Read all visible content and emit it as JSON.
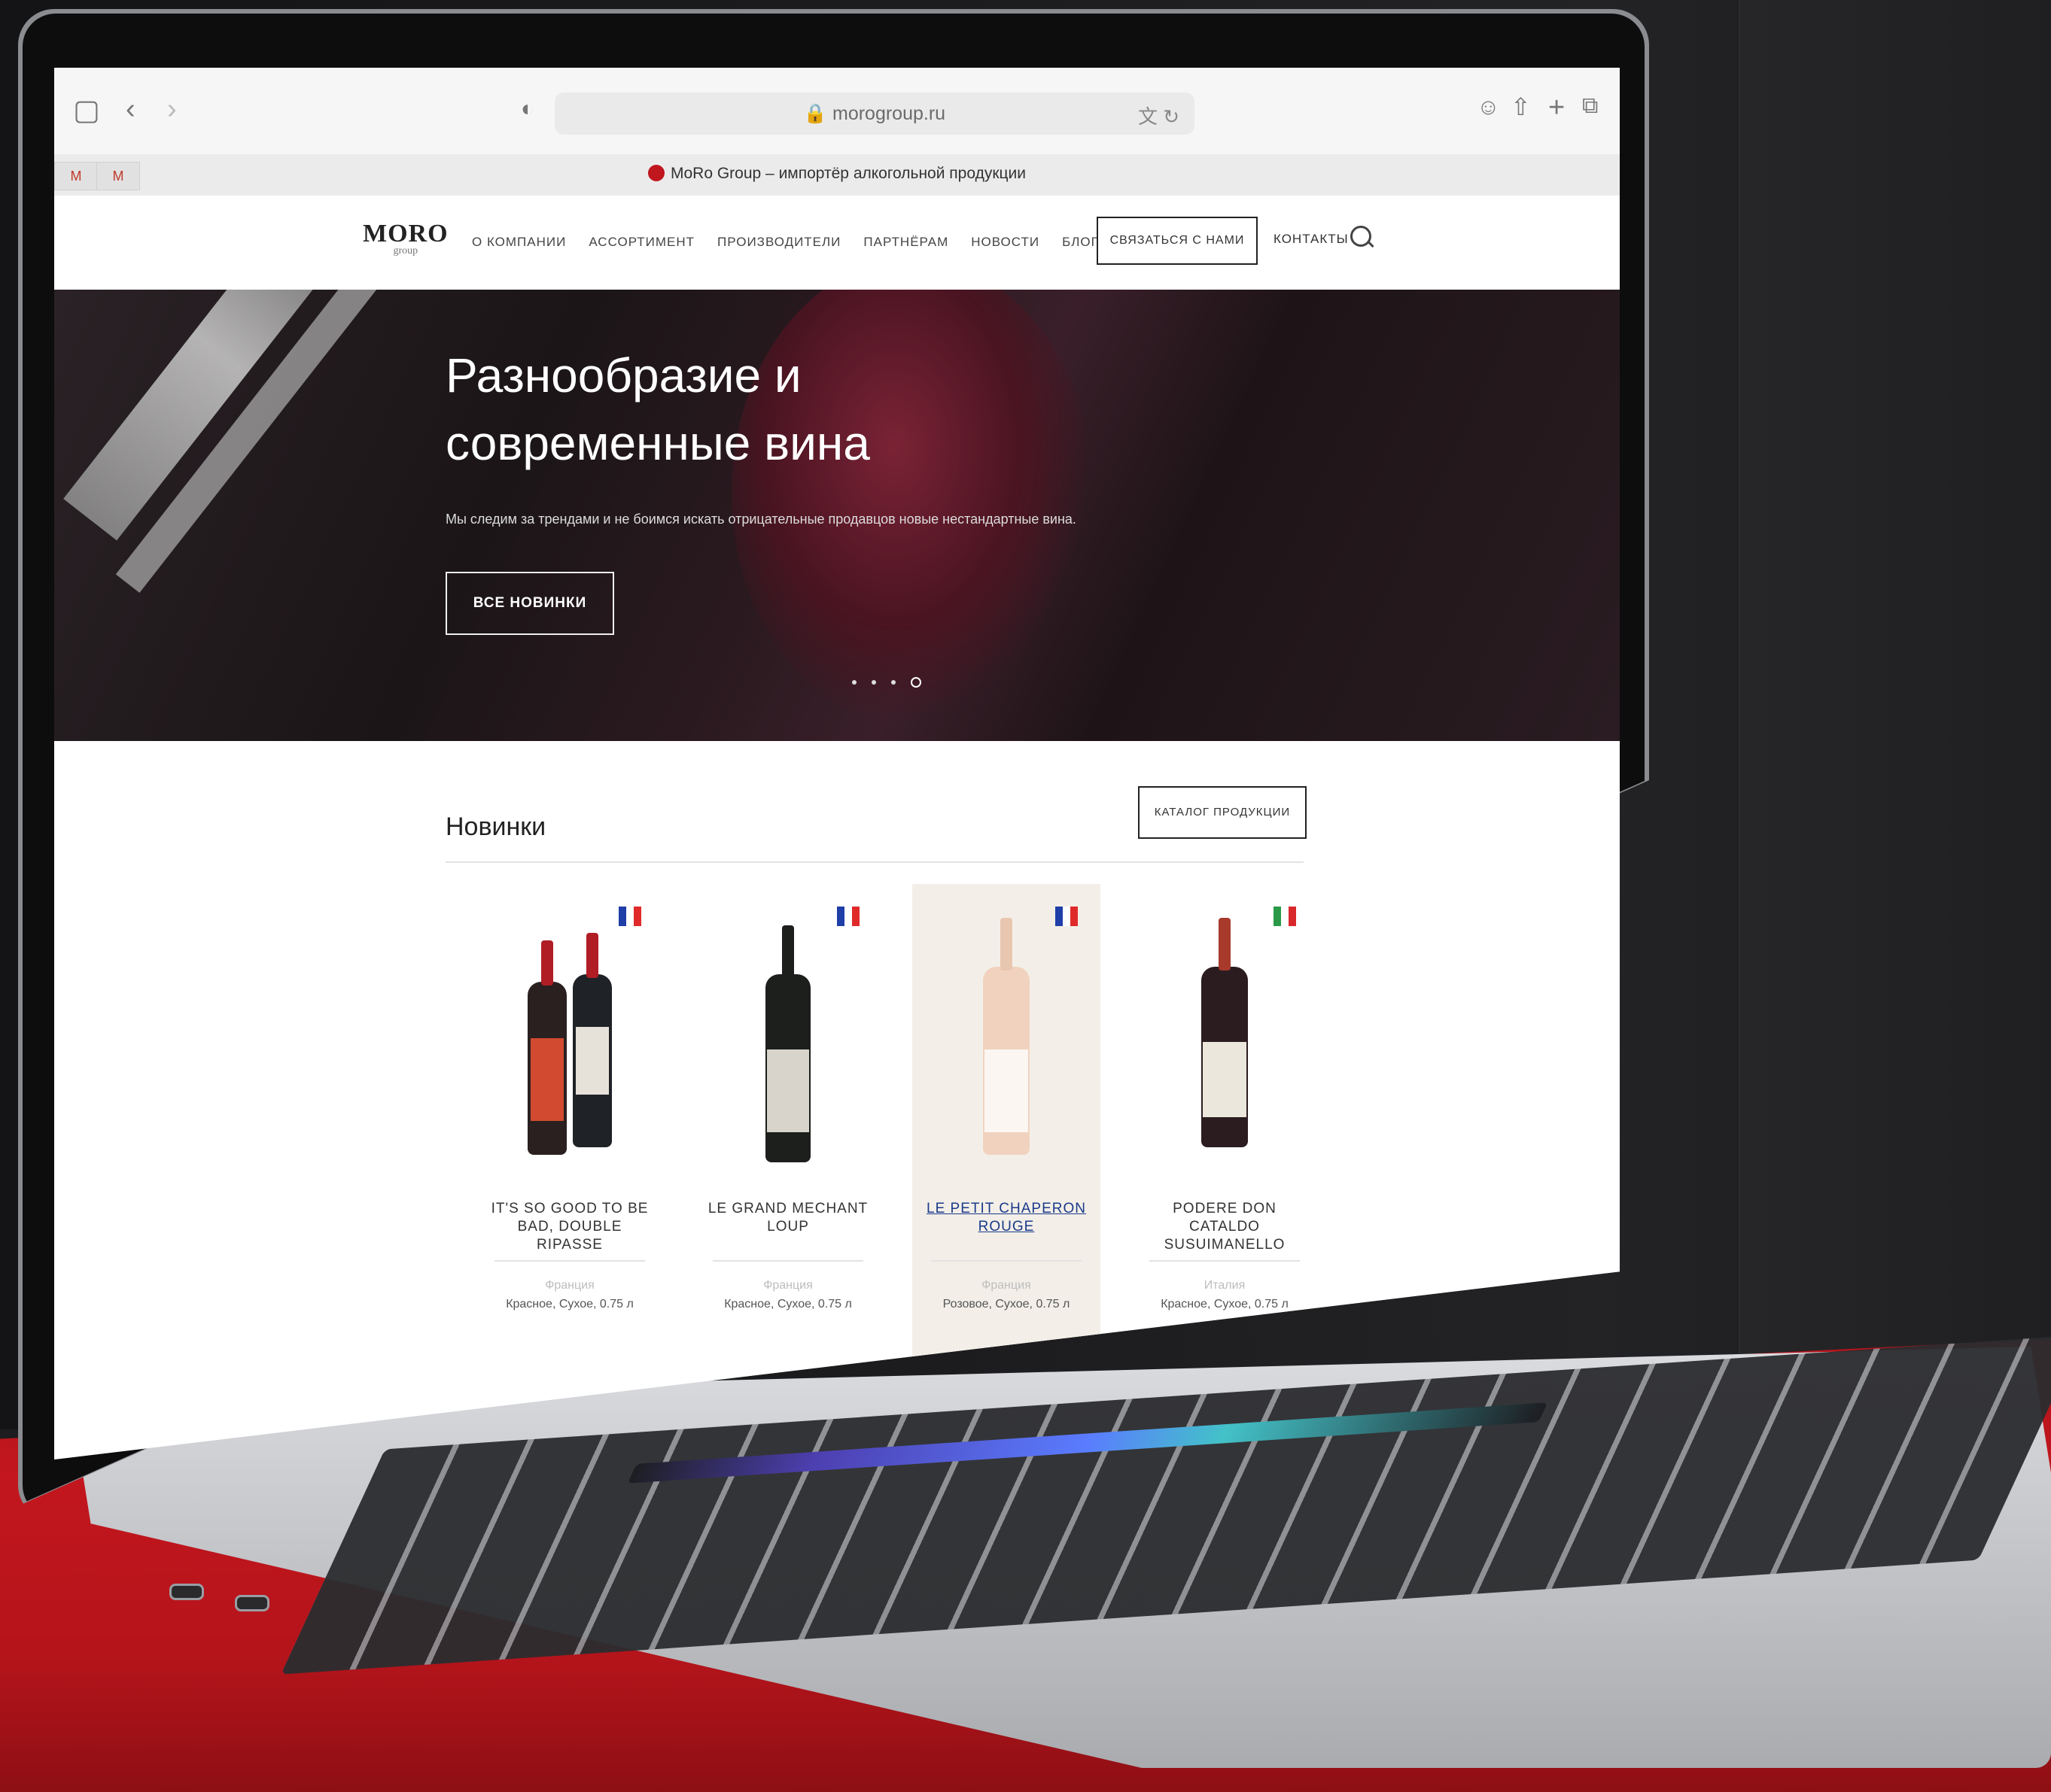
{
  "browser": {
    "url": "morogroup.ru",
    "tab_title": "MoRo Group – импортёр алкогольной продукции",
    "translate_icon": "translate-icon",
    "reload_icon": "reload-icon"
  },
  "site": {
    "logo": "MORO",
    "logo_sub": "group",
    "nav": [
      "О КОМПАНИИ",
      "АССОРТИМЕНТ",
      "ПРОИЗВОДИТЕЛИ",
      "ПАРТНЁРАМ",
      "НОВОСТИ",
      "БЛОГ"
    ],
    "contact_button": "СВЯЗАТЬСЯ С НАМИ",
    "contacts_link": "КОНТАКТЫ"
  },
  "hero": {
    "title": "Разнообразие и современные вина",
    "subtitle": "Мы следим за трендами и не боимся искать отрицательные продавцов новые нестандартные вина.",
    "button": "ВСЕ НОВИНКИ",
    "slides": 4,
    "active_slide": 4
  },
  "products_section": {
    "title": "Новинки",
    "catalog_button": "КАТАЛОГ ПРОДУКЦИИ",
    "items": [
      {
        "name": "IT'S SO GOOD TO BE BAD, DOUBLE RIPASSE",
        "country": "Франция",
        "desc": "Красное, Сухое, 0.75 л",
        "flag": "fr"
      },
      {
        "name": "LE GRAND MECHANT LOUP",
        "country": "Франция",
        "desc": "Красное, Сухое, 0.75 л",
        "flag": "fr"
      },
      {
        "name": "LE PETIT CHAPERON ROUGE",
        "country": "Франция",
        "desc": "Розовое, Сухое, 0.75 л",
        "flag": "fr"
      },
      {
        "name": "PODERE DON CATALDO SUSUIMANELLO",
        "country": "Италия",
        "desc": "Красное, Сухое, 0.75 л",
        "flag": "it"
      }
    ]
  },
  "colors": {
    "brand_red": "#c0161e",
    "table_red": "#c3161e",
    "link_blue": "#1a3a8a",
    "highlight_card": "#f3efe8"
  }
}
